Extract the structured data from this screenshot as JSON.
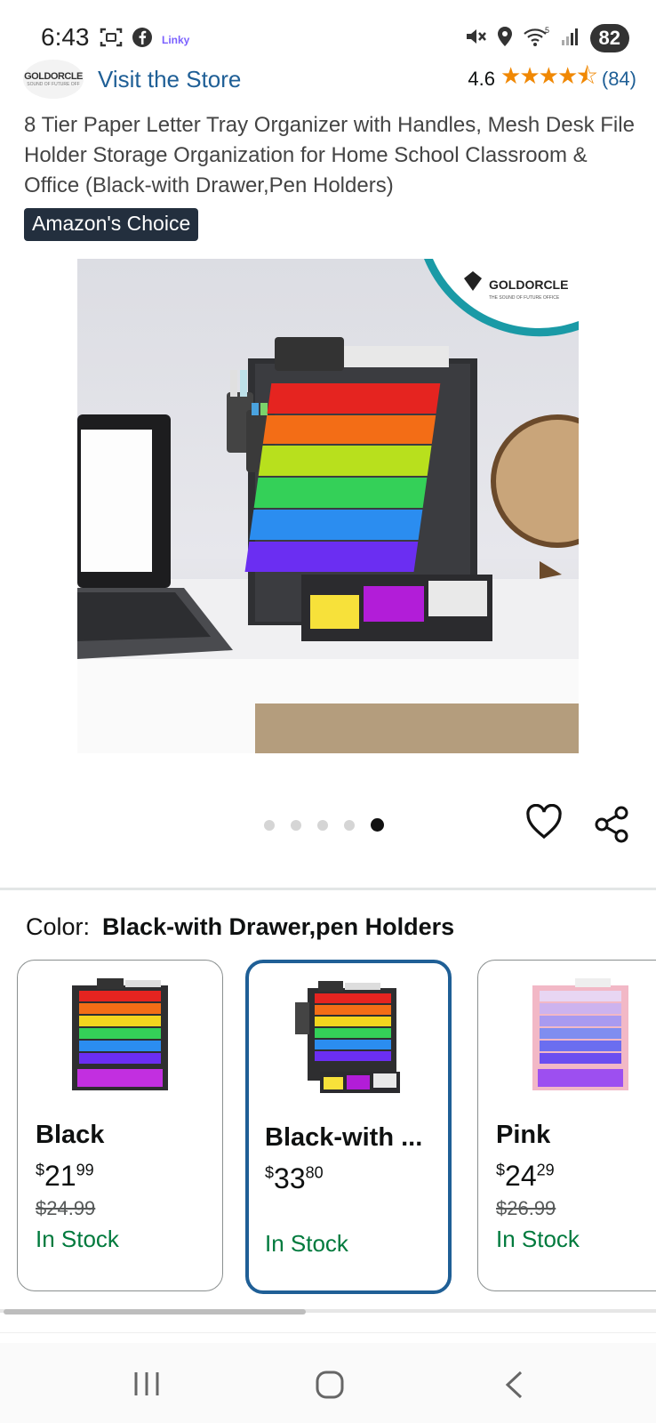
{
  "status_bar": {
    "time": "6:43",
    "app_badge": "Linky",
    "battery": "82",
    "signal_label": "5"
  },
  "store": {
    "logo_text": "GOLDORCLE",
    "logo_subtext": "SOUND OF FUTURE OFF",
    "visit_label": "Visit the Store",
    "rating": "4.6",
    "stars": "★★★★⯪",
    "review_count": "(84)"
  },
  "product": {
    "title": "8 Tier Paper Letter Tray Organizer with Handles, Mesh Desk File Holder Storage Organization for Home School Classroom & Office (Black-with Drawer,Pen Holders)",
    "badge": "Amazon's Choice",
    "image_brand": "GOLDORCLE",
    "image_brand_sub": "THE SOUND OF FUTURE OFFICE",
    "carousel": {
      "total": 5,
      "active_index": 4
    }
  },
  "variation": {
    "label": "Color:",
    "selected_value": "Black-with Drawer,pen Holders",
    "options": [
      {
        "name": "Black",
        "price_symbol": "$",
        "price_whole": "21",
        "price_fraction": "99",
        "was_price": "$24.99",
        "stock": "In Stock",
        "selected": false
      },
      {
        "name": "Black-with ...",
        "price_symbol": "$",
        "price_whole": "33",
        "price_fraction": "80",
        "was_price": "",
        "stock": "In Stock",
        "selected": true
      },
      {
        "name": "Pink",
        "price_symbol": "$",
        "price_whole": "24",
        "price_fraction": "29",
        "was_price": "$26.99",
        "stock": "In Stock",
        "selected": false
      }
    ]
  },
  "colors": {
    "link": "#1f5f96",
    "star": "#f08804",
    "in_stock": "#007a3d",
    "badge_bg": "#232f3e",
    "selected_border": "#1f5f96"
  },
  "navbar": {
    "icons": [
      "recent-apps-icon",
      "home-icon",
      "back-icon"
    ]
  }
}
